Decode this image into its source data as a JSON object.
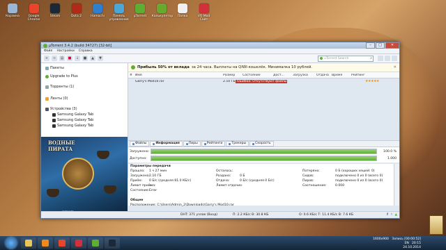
{
  "desktop_icons": [
    {
      "label": "Корзина",
      "color": "#9ab6d4"
    },
    {
      "label": "Google Chrome",
      "color": "#e9452c"
    },
    {
      "label": "Steam",
      "color": "#1b2838"
    },
    {
      "label": "Dota 2",
      "color": "#b02a1a"
    },
    {
      "label": "Hamachi",
      "color": "#2f7fd1"
    },
    {
      "label": "Панель управления",
      "color": "#4aa7d8"
    },
    {
      "label": "µTorrent",
      "color": "#5fae34"
    },
    {
      "label": "Калькулятор",
      "color": "#6aa92f"
    },
    {
      "label": "Папка",
      "color": "#f0f0f0"
    },
    {
      "label": "VO Mod Сайт",
      "color": "#d2303a"
    }
  ],
  "window": {
    "title": "µTorrent 3.4.2  (build 34727) [32-bit]",
    "menu": [
      "Файл",
      "Настройки",
      "Справка"
    ],
    "search_placeholder": "uTorrent Search",
    "controls": {
      "minimize": "–",
      "maximize": "□",
      "close": "✕"
    }
  },
  "sidebar": {
    "items": [
      {
        "label": "Пакеты",
        "icon": "packages-icon"
      },
      {
        "label": "Upgrade to Plus",
        "icon": "upgrade-icon"
      },
      {
        "label": "Торренты (1)",
        "icon": "torrents-icon"
      },
      {
        "label": "Ленты (0)",
        "icon": "feeds-icon"
      },
      {
        "label": "Устройства (3)",
        "icon": "devices-icon"
      }
    ],
    "devices": [
      "Samsung Galaxy Tab",
      "Samsung Galaxy Tab",
      "Samsung Galaxy Tab"
    ],
    "ad_label": "Реклама",
    "ad": {
      "title_line1": "ВОДНЫЕ",
      "title_line2": "ПИРАТА",
      "footer": "играть"
    }
  },
  "promo": {
    "bold": "Прибыль 50% от вклада",
    "rest": "за 24 часа. Выплаты на QIWI-кошелёк. Минималка 10 рублей."
  },
  "columns": [
    "#",
    "Имя",
    "Размер",
    "Состояние",
    "Дост...",
    "Загрузка",
    "Отдача",
    "Время",
    "Рейтинг"
  ],
  "torrent": {
    "name": "Garry's Mod10.rar",
    "size": "2.10 ГБ",
    "status": "Ошибка: Отсутствуют файлы. Повто",
    "rating": "★★★★★"
  },
  "tabs": [
    "Файлы",
    "Информация",
    "Пиры",
    "Рейтинги",
    "Трекеры",
    "Скорость"
  ],
  "active_tab": "Информация",
  "bars": [
    {
      "label": "Загружено:",
      "value": "100.0 %",
      "fill": 1.0
    },
    {
      "label": "Доступно:",
      "value": "1.000",
      "fill": 1.0
    }
  ],
  "params": {
    "title": "Параметры передачи",
    "col1": [
      {
        "k": "Прошло:",
        "v": "1 ч 27 мин"
      },
      {
        "k": "Загружено:",
        "v": "2.10 ГБ"
      },
      {
        "k": "Приём:",
        "v": "0 Б/с (средняя 81.0 КБ/с)"
      },
      {
        "k": "Лимит приёма:",
        "v": "∞"
      },
      {
        "k": "Состояние:",
        "v": "Error"
      }
    ],
    "col2": [
      {
        "k": "Осталось:",
        "v": ""
      },
      {
        "k": "Роздано:",
        "v": "0 Б"
      },
      {
        "k": "Отдача:",
        "v": "0 Б/с (средняя 0 Б/с)"
      },
      {
        "k": "Лимит отдачи:",
        "v": "∞"
      }
    ],
    "col3": [
      {
        "k": "Потеряно:",
        "v": "0 Б (хороших хешей: 0)"
      },
      {
        "k": "Сидов:",
        "v": "подключено 0 из 0 (всего 0)"
      },
      {
        "k": "Пиров:",
        "v": "подключено 0 из 0 (всего 0)"
      },
      {
        "k": "Соотношение:",
        "v": "0.000"
      }
    ],
    "general_title": "Общее",
    "location_label": "Расположение:",
    "location_value": "C:\\Users\\Admin_2\\Downloads\\Garry's Mod10.rar"
  },
  "statusbar": {
    "dht": "DHT: 371 узлов  (Вход)",
    "download": "П: 2.2 КБ/с В: 30.8 КБ",
    "upload": "О: 0.6 КБ/с Т: 11.4 КБ/с В: 7.6 КБ"
  },
  "taskbar": {
    "apps": [
      {
        "name": "explorer",
        "color": "#e7c55d"
      },
      {
        "name": "media-player",
        "color": "#f08b1a"
      },
      {
        "name": "chrome",
        "color": "#e9452c"
      },
      {
        "name": "vo-mod",
        "color": "#d2303a"
      },
      {
        "name": "utorrent",
        "color": "#5fae34"
      },
      {
        "name": "steam",
        "color": "#1b2838"
      }
    ],
    "tray_res": "1600x900",
    "tray_rec": "Запись [00:00:52]",
    "lang": "EN",
    "time": "20:15",
    "date": "24.10.2014"
  }
}
